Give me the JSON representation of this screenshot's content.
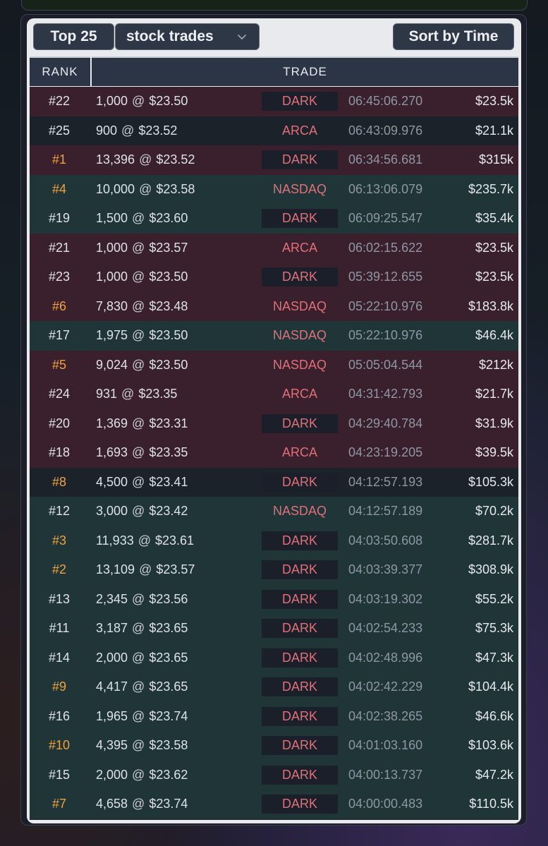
{
  "toolbar": {
    "top_label": "Top 25",
    "select_label": "stock trades",
    "sort_label": "Sort by Time"
  },
  "table": {
    "headers": [
      "RANK",
      "TRADE"
    ],
    "rows": [
      {
        "rank": "#22",
        "size": "1,000",
        "price": "$23.50",
        "venue": "DARK",
        "time": "06:45:06.270",
        "value": "$23.5k",
        "tone": "red",
        "top": false
      },
      {
        "rank": "#25",
        "size": "900",
        "price": "$23.52",
        "venue": "ARCA",
        "time": "06:43:09.976",
        "value": "$21.1k",
        "tone": "dark",
        "top": false
      },
      {
        "rank": "#1",
        "size": "13,396",
        "price": "$23.52",
        "venue": "DARK",
        "time": "06:34:56.681",
        "value": "$315k",
        "tone": "red",
        "top": true
      },
      {
        "rank": "#4",
        "size": "10,000",
        "price": "$23.58",
        "venue": "NASDAQ",
        "time": "06:13:06.079",
        "value": "$235.7k",
        "tone": "green",
        "top": true
      },
      {
        "rank": "#19",
        "size": "1,500",
        "price": "$23.60",
        "venue": "DARK",
        "time": "06:09:25.547",
        "value": "$35.4k",
        "tone": "green",
        "top": false
      },
      {
        "rank": "#21",
        "size": "1,000",
        "price": "$23.57",
        "venue": "ARCA",
        "time": "06:02:15.622",
        "value": "$23.5k",
        "tone": "red",
        "top": false
      },
      {
        "rank": "#23",
        "size": "1,000",
        "price": "$23.50",
        "venue": "DARK",
        "time": "05:39:12.655",
        "value": "$23.5k",
        "tone": "red",
        "top": false
      },
      {
        "rank": "#6",
        "size": "7,830",
        "price": "$23.48",
        "venue": "NASDAQ",
        "time": "05:22:10.976",
        "value": "$183.8k",
        "tone": "red",
        "top": true
      },
      {
        "rank": "#17",
        "size": "1,975",
        "price": "$23.50",
        "venue": "NASDAQ",
        "time": "05:22:10.976",
        "value": "$46.4k",
        "tone": "green",
        "top": false
      },
      {
        "rank": "#5",
        "size": "9,024",
        "price": "$23.50",
        "venue": "NASDAQ",
        "time": "05:05:04.544",
        "value": "$212k",
        "tone": "red",
        "top": true
      },
      {
        "rank": "#24",
        "size": "931",
        "price": "$23.35",
        "venue": "ARCA",
        "time": "04:31:42.793",
        "value": "$21.7k",
        "tone": "red",
        "top": false
      },
      {
        "rank": "#20",
        "size": "1,369",
        "price": "$23.31",
        "venue": "DARK",
        "time": "04:29:40.784",
        "value": "$31.9k",
        "tone": "red",
        "top": false
      },
      {
        "rank": "#18",
        "size": "1,693",
        "price": "$23.35",
        "venue": "ARCA",
        "time": "04:23:19.205",
        "value": "$39.5k",
        "tone": "red",
        "top": false
      },
      {
        "rank": "#8",
        "size": "4,500",
        "price": "$23.41",
        "venue": "DARK",
        "time": "04:12:57.193",
        "value": "$105.3k",
        "tone": "dark",
        "top": true
      },
      {
        "rank": "#12",
        "size": "3,000",
        "price": "$23.42",
        "venue": "NASDAQ",
        "time": "04:12:57.189",
        "value": "$70.2k",
        "tone": "green",
        "top": false
      },
      {
        "rank": "#3",
        "size": "11,933",
        "price": "$23.61",
        "venue": "DARK",
        "time": "04:03:50.608",
        "value": "$281.7k",
        "tone": "green",
        "top": true
      },
      {
        "rank": "#2",
        "size": "13,109",
        "price": "$23.57",
        "venue": "DARK",
        "time": "04:03:39.377",
        "value": "$308.9k",
        "tone": "green",
        "top": true
      },
      {
        "rank": "#13",
        "size": "2,345",
        "price": "$23.56",
        "venue": "DARK",
        "time": "04:03:19.302",
        "value": "$55.2k",
        "tone": "green",
        "top": false
      },
      {
        "rank": "#11",
        "size": "3,187",
        "price": "$23.65",
        "venue": "DARK",
        "time": "04:02:54.233",
        "value": "$75.3k",
        "tone": "green",
        "top": false
      },
      {
        "rank": "#14",
        "size": "2,000",
        "price": "$23.65",
        "venue": "DARK",
        "time": "04:02:48.996",
        "value": "$47.3k",
        "tone": "green",
        "top": false
      },
      {
        "rank": "#9",
        "size": "4,417",
        "price": "$23.65",
        "venue": "DARK",
        "time": "04:02:42.229",
        "value": "$104.4k",
        "tone": "green",
        "top": true
      },
      {
        "rank": "#16",
        "size": "1,965",
        "price": "$23.74",
        "venue": "DARK",
        "time": "04:02:38.265",
        "value": "$46.6k",
        "tone": "green",
        "top": false
      },
      {
        "rank": "#10",
        "size": "4,395",
        "price": "$23.58",
        "venue": "DARK",
        "time": "04:01:03.160",
        "value": "$103.6k",
        "tone": "green",
        "top": true
      },
      {
        "rank": "#15",
        "size": "2,000",
        "price": "$23.62",
        "venue": "DARK",
        "time": "04:00:13.737",
        "value": "$47.2k",
        "tone": "green",
        "top": false
      },
      {
        "rank": "#7",
        "size": "4,658",
        "price": "$23.74",
        "venue": "DARK",
        "time": "04:00:00.483",
        "value": "$110.5k",
        "tone": "green",
        "top": true
      }
    ]
  },
  "colors": {
    "red_row": "#3a1f2c",
    "green_row": "#1f3537",
    "dark_row": "#1b2229",
    "top_rank": "#f0a23c",
    "venue_text": "#e0707a"
  },
  "icons": {
    "select_chevron": "chevron-down-icon"
  }
}
